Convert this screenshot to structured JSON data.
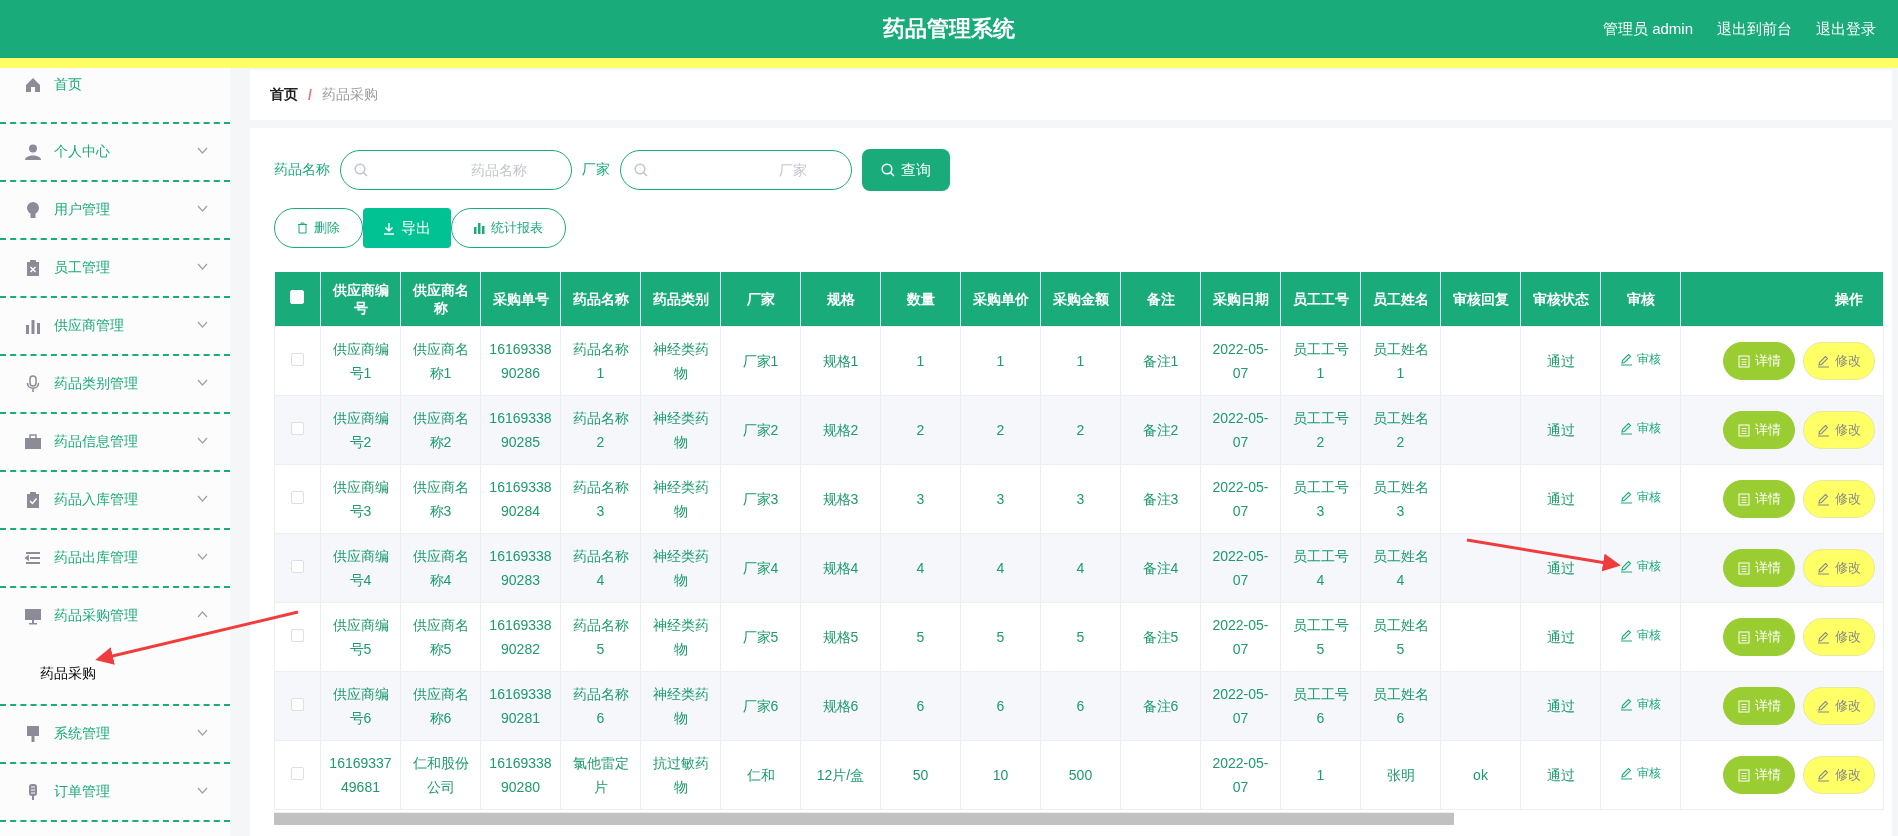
{
  "header": {
    "title": "药品管理系统",
    "links": [
      "管理员 admin",
      "退出到前台",
      "退出登录"
    ]
  },
  "sidebar": {
    "items": [
      {
        "label": "首页",
        "selected": false
      },
      {
        "label": "个人中心",
        "expanded": false
      },
      {
        "label": "用户管理",
        "expanded": false
      },
      {
        "label": "员工管理",
        "expanded": false
      },
      {
        "label": "供应商管理",
        "expanded": false
      },
      {
        "label": "药品类别管理",
        "expanded": false
      },
      {
        "label": "药品信息管理",
        "expanded": false
      },
      {
        "label": "药品入库管理",
        "expanded": false
      },
      {
        "label": "药品出库管理",
        "expanded": false
      },
      {
        "label": "药品采购管理",
        "expanded": true,
        "children": [
          {
            "label": "药品采购",
            "selected": true
          }
        ]
      },
      {
        "label": "系统管理",
        "expanded": false
      },
      {
        "label": "订单管理",
        "expanded": false
      }
    ]
  },
  "breadcrumb": [
    "首页",
    "/",
    "药品采购"
  ],
  "search": {
    "fields": [
      {
        "label": "药品名称",
        "placeholder": "药品名称"
      },
      {
        "label": "厂家",
        "placeholder": "厂家"
      }
    ],
    "button": "查询"
  },
  "toolbar": [
    {
      "kind": "outline",
      "label": "删除"
    },
    {
      "kind": "filled",
      "label": "导出"
    },
    {
      "kind": "outline",
      "label": "统计报表"
    }
  ],
  "table": {
    "select_all_checked": false,
    "columns": [
      "供应商编号",
      "供应商名称",
      "采购单号",
      "药品名称",
      "药品类别",
      "厂家",
      "规格",
      "数量",
      "采购单价",
      "采购金额",
      "备注",
      "采购日期",
      "员工工号",
      "员工姓名",
      "审核回复",
      "审核状态",
      "审核",
      "操作"
    ],
    "rows": [
      {
        "checked": false,
        "cells": [
          "供应商编号1",
          "供应商名称1",
          "1616933890286",
          "药品名称1",
          "神经类药物",
          "厂家1",
          "规格1",
          "1",
          "1",
          "1",
          "备注1",
          "2022-05-07",
          "员工工号1",
          "员工姓名1",
          null,
          "通过"
        ],
        "review": "审核",
        "actions": [
          "详情",
          "修改"
        ]
      },
      {
        "checked": false,
        "cells": [
          "供应商编号2",
          "供应商名称2",
          "1616933890285",
          "药品名称2",
          "神经类药物",
          "厂家2",
          "规格2",
          "2",
          "2",
          "2",
          "备注2",
          "2022-05-07",
          "员工工号2",
          "员工姓名2",
          null,
          "通过"
        ],
        "review": "审核",
        "actions": [
          "详情",
          "修改"
        ]
      },
      {
        "checked": false,
        "cells": [
          "供应商编号3",
          "供应商名称3",
          "1616933890284",
          "药品名称3",
          "神经类药物",
          "厂家3",
          "规格3",
          "3",
          "3",
          "3",
          "备注3",
          "2022-05-07",
          "员工工号3",
          "员工姓名3",
          null,
          "通过"
        ],
        "review": "审核",
        "actions": [
          "详情",
          "修改"
        ]
      },
      {
        "checked": false,
        "cells": [
          "供应商编号4",
          "供应商名称4",
          "1616933890283",
          "药品名称4",
          "神经类药物",
          "厂家4",
          "规格4",
          "4",
          "4",
          "4",
          "备注4",
          "2022-05-07",
          "员工工号4",
          "员工姓名4",
          null,
          "通过"
        ],
        "review": "审核",
        "actions": [
          "详情",
          "修改"
        ]
      },
      {
        "checked": false,
        "cells": [
          "供应商编号5",
          "供应商名称5",
          "1616933890282",
          "药品名称5",
          "神经类药物",
          "厂家5",
          "规格5",
          "5",
          "5",
          "5",
          "备注5",
          "2022-05-07",
          "员工工号5",
          "员工姓名5",
          null,
          "通过"
        ],
        "review": "审核",
        "actions": [
          "详情",
          "修改"
        ]
      },
      {
        "checked": false,
        "cells": [
          "供应商编号6",
          "供应商名称6",
          "1616933890281",
          "药品名称6",
          "神经类药物",
          "厂家6",
          "规格6",
          "6",
          "6",
          "6",
          "备注6",
          "2022-05-07",
          "员工工号6",
          "员工姓名6",
          null,
          "通过"
        ],
        "review": "审核",
        "actions": [
          "详情",
          "修改"
        ]
      },
      {
        "checked": false,
        "cells": [
          "1616933749681",
          "仁和股份公司",
          "1616933890280",
          "氯他雷定片",
          "抗过敏药物",
          "仁和",
          "12片/盒",
          "50",
          "10",
          "500",
          null,
          "2022-05-07",
          "1",
          "张明",
          "ok",
          "通过"
        ],
        "review": "审核",
        "actions": [
          "详情",
          "修改"
        ]
      }
    ]
  }
}
